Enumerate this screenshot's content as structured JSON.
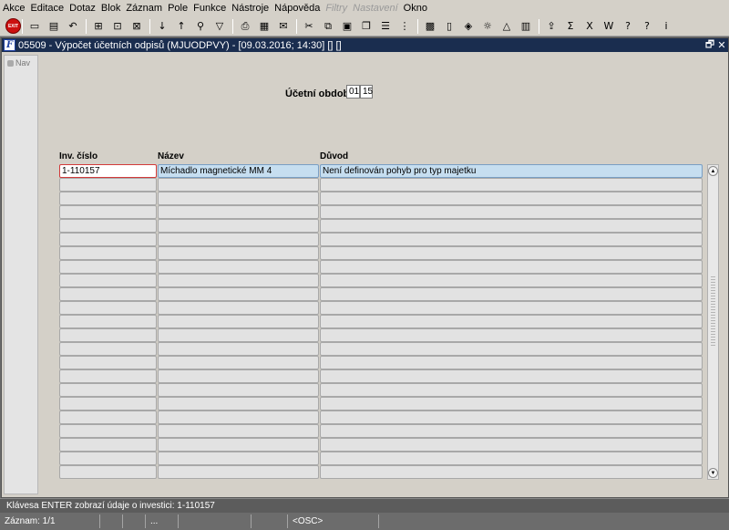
{
  "menu": [
    "Akce",
    "Editace",
    "Dotaz",
    "Blok",
    "Záznam",
    "Pole",
    "Funkce",
    "Nástroje",
    "Nápověda",
    "Filtry",
    "Nastavení",
    "Okno"
  ],
  "menu_disabled": [
    "Filtry",
    "Nastavení"
  ],
  "toolbar": {
    "exit_label": "EXIT",
    "icons": [
      "save-icon",
      "print-preview-icon",
      "undo-icon",
      "enter-query-icon",
      "execute-query-icon",
      "cancel-query-icon",
      "sort-asc-icon",
      "sort-desc-icon",
      "search-icon",
      "filter-icon",
      "print-icon",
      "report-icon",
      "mail-icon",
      "cut-icon",
      "copy-icon",
      "paste-icon",
      "duplicate-icon",
      "list-icon",
      "tree-icon",
      "calculator-icon",
      "document-icon",
      "package-icon",
      "sun-icon",
      "warning-icon",
      "chart-icon",
      "export-icon",
      "sum-icon",
      "excel-icon",
      "word-icon",
      "help-icon",
      "info-icon",
      "about-icon"
    ]
  },
  "window": {
    "title": "05509 - Výpočet účetních odpisů (MJUODPVY) - [09.03.2016; 14:30] [] []",
    "app_icon": "F",
    "restore_label": "🗗",
    "close_label": "✕"
  },
  "nav": {
    "label": "Nav"
  },
  "form": {
    "period_label": "Účetní období",
    "period_month": "01",
    "period_year": "15"
  },
  "table": {
    "headers": [
      "Inv. číslo",
      "Název",
      "Důvod"
    ],
    "rows": [
      [
        "1-110157",
        "Míchadlo magnetické MM 4",
        "Není definován pohyb pro typ majetku"
      ],
      [
        "",
        "",
        ""
      ],
      [
        "",
        "",
        ""
      ],
      [
        "",
        "",
        ""
      ],
      [
        "",
        "",
        ""
      ],
      [
        "",
        "",
        ""
      ],
      [
        "",
        "",
        ""
      ],
      [
        "",
        "",
        ""
      ],
      [
        "",
        "",
        ""
      ],
      [
        "",
        "",
        ""
      ],
      [
        "",
        "",
        ""
      ],
      [
        "",
        "",
        ""
      ],
      [
        "",
        "",
        ""
      ],
      [
        "",
        "",
        ""
      ],
      [
        "",
        "",
        ""
      ],
      [
        "",
        "",
        ""
      ],
      [
        "",
        "",
        ""
      ],
      [
        "",
        "",
        ""
      ],
      [
        "",
        "",
        ""
      ],
      [
        "",
        "",
        ""
      ],
      [
        "",
        "",
        ""
      ],
      [
        "",
        "",
        ""
      ],
      [
        "",
        "",
        ""
      ]
    ]
  },
  "status": {
    "message": "Klávesa ENTER zobrazí údaje o investici: 1-110157",
    "record": "Záznam: 1/1",
    "field2": "",
    "field3": "",
    "field4": "...",
    "field5": "",
    "mode": "<OSC>"
  }
}
